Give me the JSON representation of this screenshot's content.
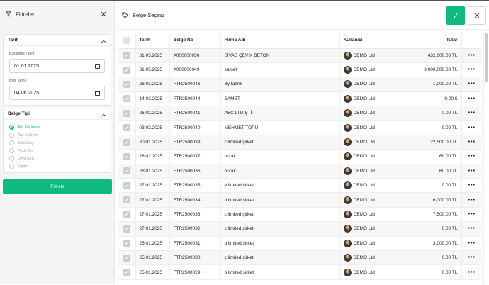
{
  "filters": {
    "title": "Filtreler",
    "date_section": {
      "title": "Tarih",
      "start_label": "Başlangıç Tarihi",
      "start_value": "01.01.2025",
      "end_label": "Bitiş Tarihi",
      "end_value": "04.06.2025"
    },
    "doc_type_section": {
      "title": "Belge Tipi",
      "options": [
        "Alış Faturaları",
        "Alış İrsaliyesi",
        "Stok Giriş",
        "Peşin Alış",
        "Devir Giriş",
        "Sepet"
      ],
      "selected": "Alış Faturaları"
    },
    "apply_label": "Filtrele"
  },
  "main": {
    "title": "Belge Seçiniz"
  },
  "table": {
    "headers": [
      "Tarih",
      "Belge No",
      "Firma Adı",
      "Kullanıcı",
      "Tutar"
    ],
    "rows": [
      [
        "31.05.2025",
        "A000000050",
        "SİVAS ÇEVİK BETON",
        "DEMO Ltd",
        "432,000.00 TL"
      ],
      [
        "31.05.2025",
        "A000000049",
        "samet",
        "DEMO Ltd",
        "3,000,000.00 TL"
      ],
      [
        "26.03.2025",
        "FTR2500046",
        "By fabrik",
        "DEMO Ltd",
        "1,000.00 TL"
      ],
      [
        "14.03.2025",
        "FTR2500044",
        "SAMET",
        "DEMO Ltd",
        "0.00 $"
      ],
      [
        "26.02.2025",
        "FTR2500041",
        "ABC LTD.ŞTİ.",
        "DEMO Ltd",
        "0.00 TL"
      ],
      [
        "03.02.2025",
        "FTR2500040",
        "MEHMET TOPU",
        "DEMO Ltd",
        "0.00 TL"
      ],
      [
        "30.01.2025",
        "FTR2500039",
        "c limited şirketi",
        "DEMO Ltd",
        "22,500.00 TL"
      ],
      [
        "28.01.2025",
        "FTR2500037",
        "burak",
        "DEMO Ltd",
        "60.00 TL"
      ],
      [
        "28.01.2025",
        "FTR2500036",
        "burak",
        "DEMO Ltd",
        "60.00 TL"
      ],
      [
        "27.01.2025",
        "FTR2500035",
        "e limited şirketi",
        "DEMO Ltd",
        "0.00 TL"
      ],
      [
        "27.01.2025",
        "FTR2500034",
        "d limited şirketi",
        "DEMO Ltd",
        "6,000.00 TL"
      ],
      [
        "27.01.2025",
        "FTR2500033",
        "c limited şirketi",
        "DEMO Ltd",
        "7,500.00 TL"
      ],
      [
        "27.01.2025",
        "FTR2500032",
        "c limited şirketi",
        "DEMO Ltd",
        "0.00 TL"
      ],
      [
        "25.01.2025",
        "FTR2500031",
        "b limited şirketi",
        "DEMO Ltd",
        "3,000.00 TL"
      ],
      [
        "25.01.2025",
        "FTR2500030",
        "c limited şirketi",
        "DEMO Ltd",
        "0.00 TL"
      ],
      [
        "25.01.2025",
        "FTR2500029",
        "b limited şirketi",
        "DEMO Ltd",
        "0.00 TL"
      ]
    ],
    "row_menu": "•••"
  },
  "colors": {
    "accent": "#10b981"
  }
}
